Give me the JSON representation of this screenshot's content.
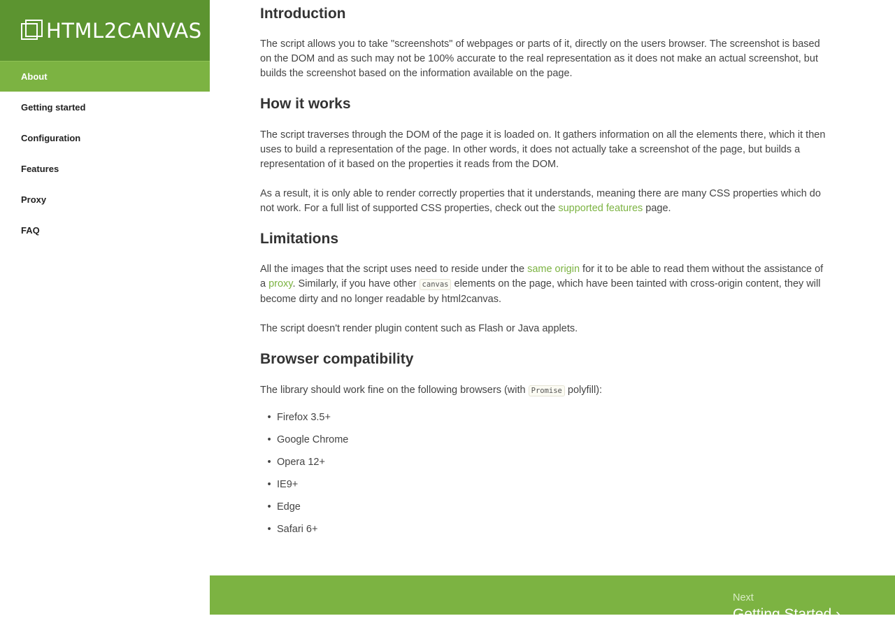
{
  "logo": {
    "text": "HTML2CANVAS"
  },
  "sidebar": {
    "items": [
      {
        "label": "About",
        "active": true
      },
      {
        "label": "Getting started"
      },
      {
        "label": "Configuration"
      },
      {
        "label": "Features"
      },
      {
        "label": "Proxy"
      },
      {
        "label": "FAQ"
      }
    ]
  },
  "content": {
    "intro": {
      "heading": "Introduction",
      "text": "The script allows you to take \"screenshots\" of webpages or parts of it, directly on the users browser. The screenshot is based on the DOM and as such may not be 100% accurate to the real representation as it does not make an actual screenshot, but builds the screenshot based on the information available on the page."
    },
    "how": {
      "heading": "How it works",
      "p1": "The script traverses through the DOM of the page it is loaded on. It gathers information on all the elements there, which it then uses to build a representation of the page. In other words, it does not actually take a screenshot of the page, but builds a representation of it based on the properties it reads from the DOM.",
      "p2_a": "As a result, it is only able to render correctly properties that it understands, meaning there are many CSS properties which do not work. For a full list of supported CSS properties, check out the ",
      "p2_link": "supported features",
      "p2_b": " page."
    },
    "limitations": {
      "heading": "Limitations",
      "p1_a": "All the images that the script uses need to reside under the ",
      "p1_link1": "same origin",
      "p1_b": " for it to be able to read them without the assistance of a ",
      "p1_link2": "proxy",
      "p1_c": ". Similarly, if you have other ",
      "p1_code": "canvas",
      "p1_d": " elements on the page, which have been tainted with cross-origin content, they will become dirty and no longer readable by html2canvas.",
      "p2": "The script doesn't render plugin content such as Flash or Java applets."
    },
    "browser": {
      "heading": "Browser compatibility",
      "intro_a": "The library should work fine on the following browsers (with ",
      "intro_code": "Promise",
      "intro_b": " polyfill):",
      "list": [
        "Firefox 3.5+",
        "Google Chrome",
        "Opera 12+",
        "IE9+",
        "Edge",
        "Safari 6+"
      ]
    }
  },
  "footer": {
    "next_label": "Next",
    "next_title": "Getting Started ›"
  },
  "colors": {
    "brand_dark": "#5c9430",
    "brand": "#7cb342"
  }
}
